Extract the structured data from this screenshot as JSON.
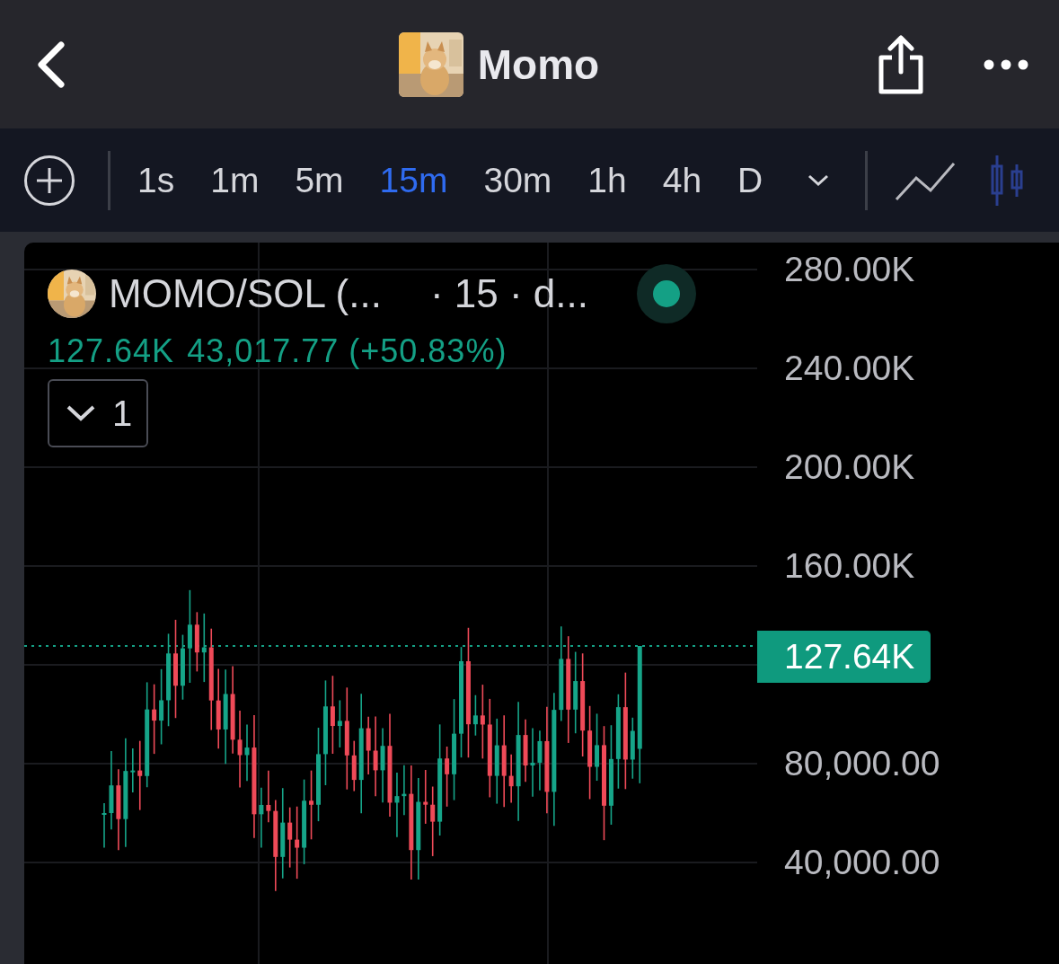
{
  "header": {
    "title": "Momo"
  },
  "toolbar": {
    "intervals": [
      {
        "label": "1s",
        "selected": false
      },
      {
        "label": "1m",
        "selected": false
      },
      {
        "label": "5m",
        "selected": false
      },
      {
        "label": "15m",
        "selected": true
      },
      {
        "label": "30m",
        "selected": false
      },
      {
        "label": "1h",
        "selected": false
      },
      {
        "label": "4h",
        "selected": false
      },
      {
        "label": "D",
        "selected": false
      }
    ]
  },
  "legend": {
    "symbol": "MOMO/SOL (...",
    "details": "· 15 · d...",
    "live": true,
    "last": "127.64K",
    "change": "43,017.77 (+50.83%)",
    "indicator_count": "1"
  },
  "price_axis": [
    {
      "kind": "tick",
      "label": "280.00K"
    },
    {
      "kind": "tick",
      "label": "240.00K"
    },
    {
      "kind": "tick",
      "label": "200.00K"
    },
    {
      "kind": "tick",
      "label": "160.00K"
    },
    {
      "kind": "price",
      "label": "127.64K"
    },
    {
      "kind": "tick",
      "label": "80,000.00"
    },
    {
      "kind": "tick",
      "label": "40,000.00"
    }
  ]
}
